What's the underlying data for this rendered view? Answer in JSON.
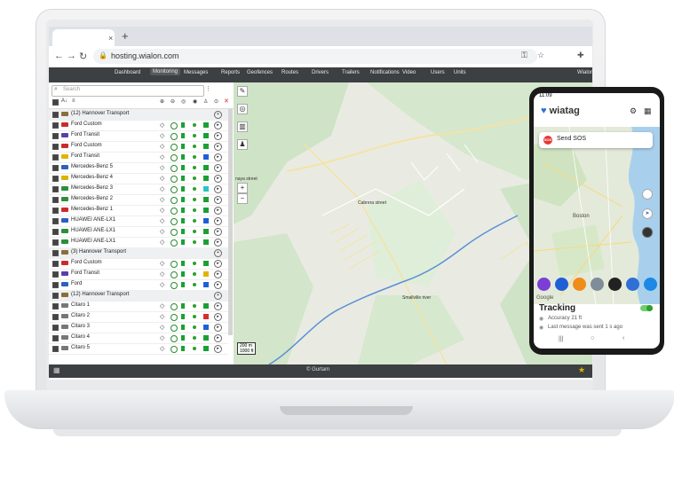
{
  "browser": {
    "url": "hosting.wialon.com",
    "back_icon": "←",
    "forward_icon": "→",
    "reload_icon": "↻",
    "close_tab": "×",
    "new_tab": "+"
  },
  "appnav": {
    "items": [
      "Dashboard",
      "Monitoring",
      "Messages",
      "Reports",
      "Geofences",
      "Routes",
      "Drivers",
      "Trailers",
      "Notifications",
      "Video",
      "Users",
      "Units"
    ],
    "active": "Monitoring",
    "user": "Wialon"
  },
  "panel": {
    "search_placeholder": "Search",
    "rows": [
      {
        "label": "(12) Hannover Transport",
        "group": true
      },
      {
        "label": "Ford Custom",
        "color": "#cc2b2b",
        "s5": "#1aa035"
      },
      {
        "label": "Ford Transit",
        "color": "#5a3fa8",
        "s5": "#1aa035"
      },
      {
        "label": "Ford Custom",
        "color": "#cc2b2b",
        "s5": "#1aa035"
      },
      {
        "label": "Ford Transit",
        "color": "#e0b400",
        "s5": "#1e5fd8"
      },
      {
        "label": "Mercedes-Benz 5",
        "color": "#2f5fbf",
        "s5": "#1aa035"
      },
      {
        "label": "Mercedes-Benz 4",
        "color": "#d9b400",
        "s5": "#1aa035"
      },
      {
        "label": "Mercedes-Benz 3",
        "color": "#2a8f3a",
        "s5": "#26c6c6"
      },
      {
        "label": "Mercedes-Benz 2",
        "color": "#2a8f3a",
        "s5": "#1aa035"
      },
      {
        "label": "Mercedes-Benz 1",
        "color": "#cc2b2b",
        "s5": "#1aa035"
      },
      {
        "label": "HUAWEI ANE-LX1",
        "color": "#2f5fbf",
        "s5": "#1e5fd8"
      },
      {
        "label": "HUAWEI ANE-LX1",
        "color": "#2a8f3a",
        "s5": "#1aa035"
      },
      {
        "label": "HUAWEI ANE-LX1",
        "color": "#2a8f3a",
        "s5": "#1aa035"
      },
      {
        "label": "(3) Hannover Transport",
        "group": true
      },
      {
        "label": "Ford Custom",
        "color": "#cc2b2b",
        "s5": "#1aa035"
      },
      {
        "label": "Ford Transit",
        "color": "#5a3fa8",
        "s5": "#e0b400"
      },
      {
        "label": "Ford",
        "color": "#2f5fbf",
        "s5": "#1e5fd8"
      },
      {
        "label": "(12) Hannover Transport",
        "group": true
      },
      {
        "label": "Citaro 1",
        "color": "#777777",
        "s5": "#1aa035"
      },
      {
        "label": "Citaro 2",
        "color": "#777777",
        "s5": "#d32f2f"
      },
      {
        "label": "Citaro 3",
        "color": "#777777",
        "s5": "#1e5fd8"
      },
      {
        "label": "Citaro 4",
        "color": "#777777",
        "s5": "#1aa035"
      },
      {
        "label": "Citaro 5",
        "color": "#777777",
        "s5": "#1aa035"
      }
    ]
  },
  "map": {
    "labels": [
      "Cabrera street",
      "Smallville river",
      "naya street"
    ],
    "scale_top": "200 m",
    "scale_bottom": "1000 ft"
  },
  "footer": {
    "text": "© Gurtam"
  },
  "phone": {
    "time": "11:09",
    "app_name": "wiatag",
    "sos_label": "Send SOS",
    "city": "Boston",
    "google": "Google",
    "tracking_title": "Tracking",
    "accuracy": "Accuracy 21 ft",
    "last_message": "Last message was sent 1 s ago"
  }
}
